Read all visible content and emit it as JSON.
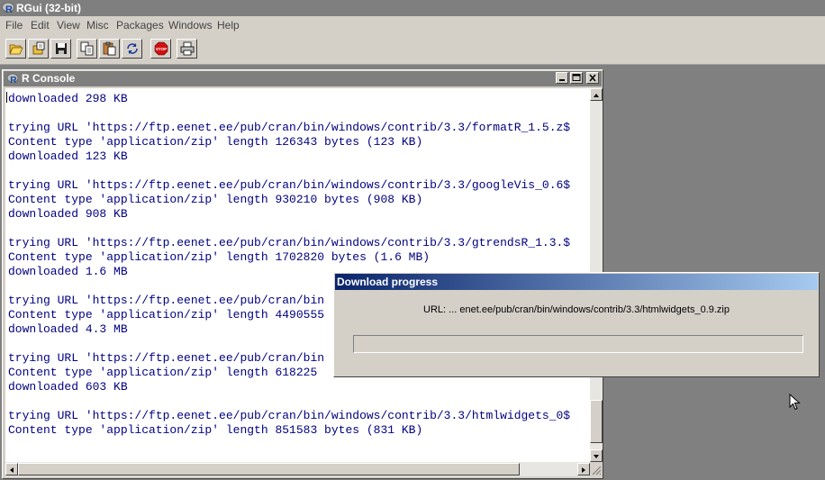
{
  "app": {
    "title": "RGui (32-bit)"
  },
  "menu": [
    "File",
    "Edit",
    "View",
    "Misc",
    "Packages",
    "Windows",
    "Help"
  ],
  "toolbar": {
    "buttons": [
      "open-script",
      "load-workspace",
      "save-workspace",
      "copy",
      "paste",
      "copy-and-paste",
      "stop",
      "print"
    ],
    "stop_label": "STOP"
  },
  "console": {
    "title": "R Console",
    "lines": [
      "downloaded 298 KB",
      "",
      "trying URL 'https://ftp.eenet.ee/pub/cran/bin/windows/contrib/3.3/formatR_1.5.z$",
      "Content type 'application/zip' length 126343 bytes (123 KB)",
      "downloaded 123 KB",
      "",
      "trying URL 'https://ftp.eenet.ee/pub/cran/bin/windows/contrib/3.3/googleVis_0.6$",
      "Content type 'application/zip' length 930210 bytes (908 KB)",
      "downloaded 908 KB",
      "",
      "trying URL 'https://ftp.eenet.ee/pub/cran/bin/windows/contrib/3.3/gtrendsR_1.3.$",
      "Content type 'application/zip' length 1702820 bytes (1.6 MB)",
      "downloaded 1.6 MB",
      "",
      "trying URL 'https://ftp.eenet.ee/pub/cran/bin",
      "Content type 'application/zip' length 4490555",
      "downloaded 4.3 MB",
      "",
      "trying URL 'https://ftp.eenet.ee/pub/cran/bin",
      "Content type 'application/zip' length 618225",
      "downloaded 603 KB",
      "",
      "trying URL 'https://ftp.eenet.ee/pub/cran/bin/windows/contrib/3.3/htmlwidgets_0$",
      "Content type 'application/zip' length 851583 bytes (831 KB)"
    ]
  },
  "dialog": {
    "title": "Download progress",
    "url_text": "URL: ... enet.ee/pub/cran/bin/windows/contrib/3.3/htmlwidgets_0.9.zip",
    "progress": 0
  },
  "colors": {
    "console_text": "#000080",
    "dialog_title_start": "#0a246a",
    "dialog_title_end": "#a6caf0"
  }
}
